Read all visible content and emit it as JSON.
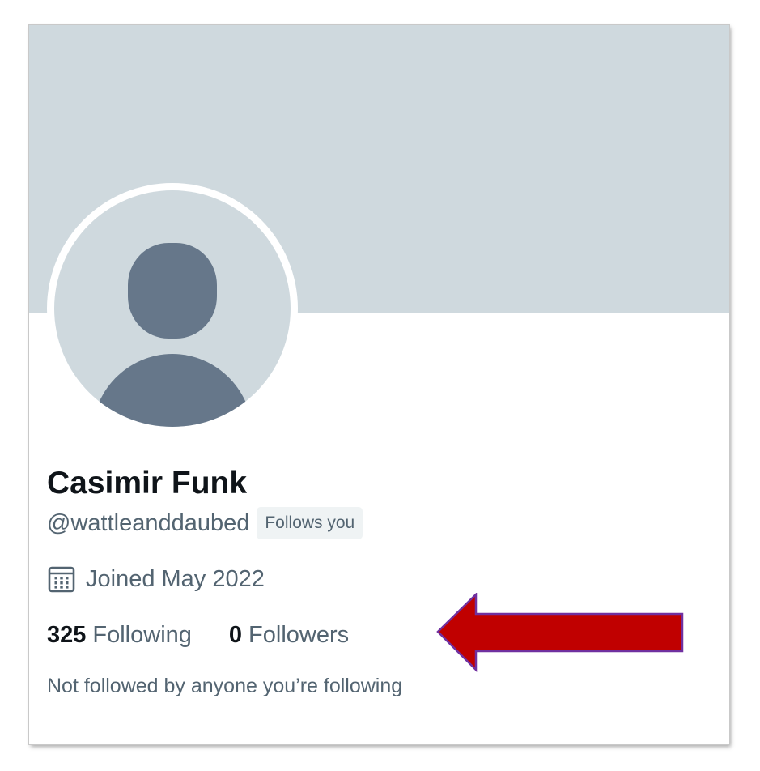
{
  "profile": {
    "display_name": "Casimir Funk",
    "handle": "@wattleanddaubed",
    "follows_you_badge": "Follows you",
    "joined": "Joined May 2022",
    "mutuals_note": "Not followed by anyone you’re following"
  },
  "stats": {
    "following": {
      "count": "325",
      "label": "Following"
    },
    "followers": {
      "count": "0",
      "label": "Followers"
    }
  },
  "icons": {
    "joined": "calendar-icon",
    "avatar": "default-user-silhouette-icon",
    "annotation": "red-arrow-left-icon"
  },
  "colors": {
    "banner": "#cfd9de",
    "avatar_bg": "#cfd9de",
    "avatar_silhouette": "#66778a",
    "primary_text": "#0f1419",
    "secondary_text": "#536471",
    "badge_bg": "#eff3f4",
    "arrow_fill": "#c00000",
    "arrow_stroke": "#7030a0"
  }
}
